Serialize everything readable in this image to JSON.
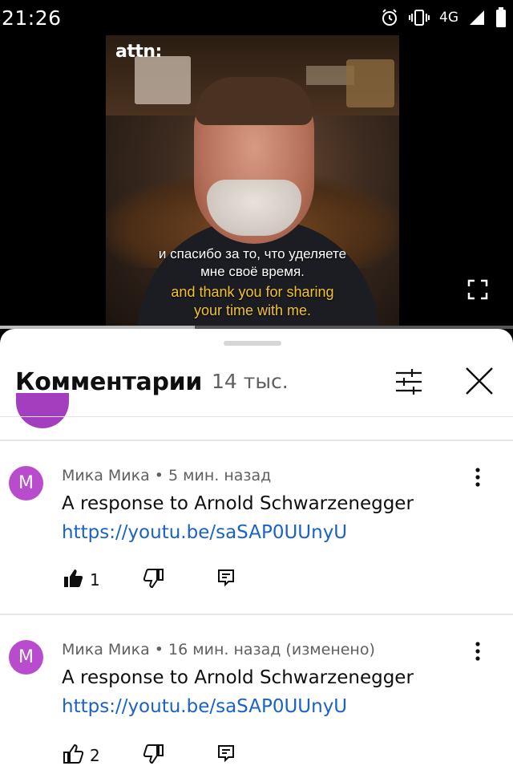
{
  "status_bar": {
    "time": "21:26",
    "network": "4G",
    "icons": [
      "alarm-icon",
      "vibrate-icon",
      "signal-icon",
      "battery-icon"
    ]
  },
  "video": {
    "brand_watermark": "attn:",
    "subtitle_ru_line1": "и спасибо за то, что уделяете",
    "subtitle_ru_line2": "мне своё время.",
    "subtitle_en_line1": "and thank you for sharing",
    "subtitle_en_line2": "your time with me.",
    "progress_fraction": 0.38
  },
  "comments_sheet": {
    "title": "Комментарии",
    "count": "14 тыс.",
    "comments": [
      {
        "avatar_letter": "M",
        "meta": "Мика Мика • 5 мин. назад",
        "text": "A response to Arnold Schwarzenegger",
        "link": "https://youtu.be/saSAP0UUnyU",
        "likes": "1",
        "liked": true
      },
      {
        "avatar_letter": "M",
        "meta": "Мика Мика • 16 мин. назад (изменено)",
        "text": "A response to Arnold Schwarzenegger",
        "link": "https://youtu.be/saSAP0UUnyU",
        "likes": "2",
        "liked": false
      }
    ]
  },
  "colors": {
    "avatar": "#b94ccc",
    "link": "#1a62c8",
    "subtitle_en": "#f2c230"
  }
}
